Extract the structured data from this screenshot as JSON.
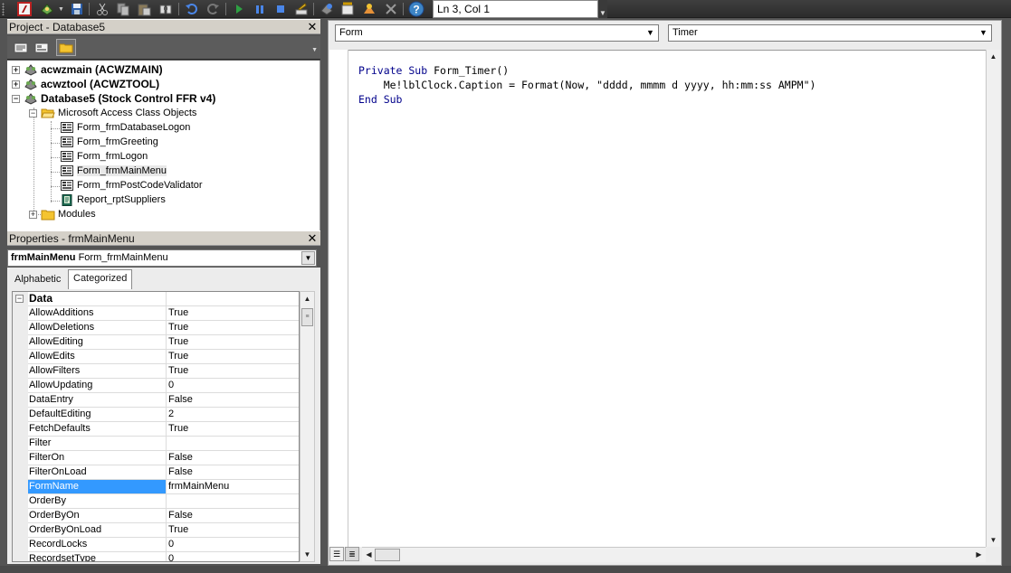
{
  "toolbar": {
    "position": "Ln 3, Col 1",
    "buttons": [
      "view-access-icon",
      "insert-module-icon",
      "save-icon",
      "cut-icon",
      "copy-icon",
      "paste-icon",
      "find-icon",
      "undo-icon",
      "redo-icon",
      "run-icon",
      "break-icon",
      "reset-icon",
      "design-mode-icon",
      "project-explorer-icon",
      "properties-window-icon",
      "object-browser-icon",
      "toolbox-icon",
      "help-icon"
    ]
  },
  "project": {
    "title": "Project - Database5",
    "tree": [
      {
        "label": "acwzmain (ACWZMAIN)",
        "bold": true,
        "expander": "+"
      },
      {
        "label": "acwztool (ACWZTOOL)",
        "bold": true,
        "expander": "+"
      },
      {
        "label": "Database5 (Stock Control FFR v4)",
        "bold": true,
        "expander": "−"
      },
      {
        "label": "Microsoft Access Class Objects",
        "expander": "−"
      },
      {
        "label": "Form_frmDatabaseLogon"
      },
      {
        "label": "Form_frmGreeting"
      },
      {
        "label": "Form_frmLogon"
      },
      {
        "label": "Form_frmMainMenu",
        "selected": true
      },
      {
        "label": "Form_frmPostCodeValidator"
      },
      {
        "label": "Report_rptSuppliers"
      },
      {
        "label": "Modules",
        "expander": "+"
      }
    ]
  },
  "properties": {
    "title": "Properties - frmMainMenu",
    "object_name": "frmMainMenu",
    "object_type": "Form_frmMainMenu",
    "tabs": [
      "Alphabetic",
      "Categorized"
    ],
    "active_tab": "Categorized",
    "category": "Data",
    "category_expander": "−",
    "rows": [
      {
        "name": "AllowAdditions",
        "value": "True"
      },
      {
        "name": "AllowDeletions",
        "value": "True"
      },
      {
        "name": "AllowEditing",
        "value": "True"
      },
      {
        "name": "AllowEdits",
        "value": "True"
      },
      {
        "name": "AllowFilters",
        "value": "True"
      },
      {
        "name": "AllowUpdating",
        "value": "0"
      },
      {
        "name": "DataEntry",
        "value": "False"
      },
      {
        "name": "DefaultEditing",
        "value": "2"
      },
      {
        "name": "FetchDefaults",
        "value": "True"
      },
      {
        "name": "Filter",
        "value": ""
      },
      {
        "name": "FilterOn",
        "value": "False"
      },
      {
        "name": "FilterOnLoad",
        "value": "False"
      },
      {
        "name": "FormName",
        "value": "frmMainMenu",
        "selected": true
      },
      {
        "name": "OrderBy",
        "value": ""
      },
      {
        "name": "OrderByOn",
        "value": "False"
      },
      {
        "name": "OrderByOnLoad",
        "value": "True"
      },
      {
        "name": "RecordLocks",
        "value": "0"
      },
      {
        "name": "RecordsetType",
        "value": "0"
      }
    ]
  },
  "code": {
    "object_combo": "Form",
    "procedure_combo": "Timer",
    "lines": [
      {
        "kw1": "Private Sub",
        "rest": " Form_Timer()"
      },
      {
        "kw1": "",
        "rest": "    Me!lblClock.Caption = Format(Now, \"dddd, mmmm d yyyy, hh:mm:ss AMPM\")"
      },
      {
        "kw1": "End Sub",
        "rest": ""
      }
    ]
  },
  "colors": {
    "selection": "#3399ff",
    "keyword": "#00008b"
  }
}
